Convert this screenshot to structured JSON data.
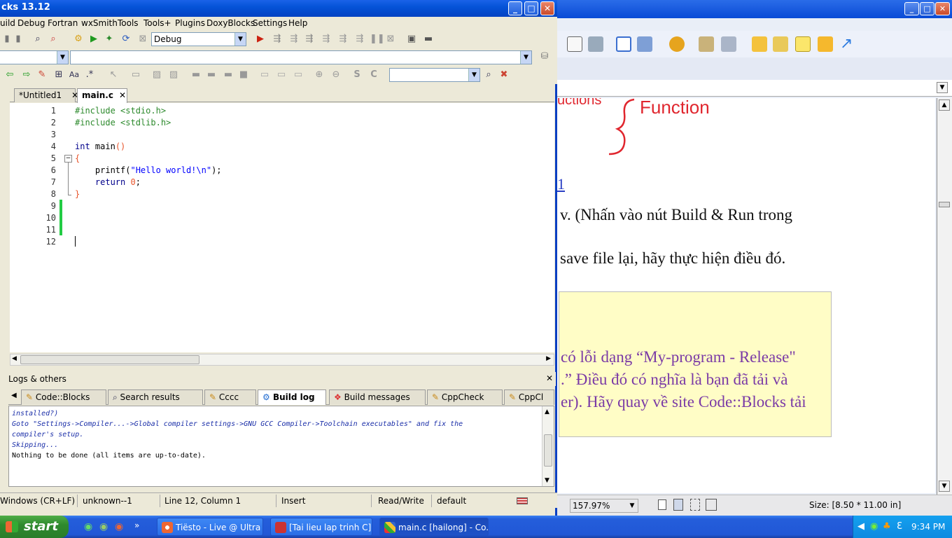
{
  "cb": {
    "title": "cks 13.12",
    "menus": [
      "uild",
      "Debug",
      "Fortran",
      "wxSmith",
      "Tools",
      "Tools+",
      "Plugins",
      "DoxyBlocks",
      "Settings",
      "Help"
    ],
    "build_target": "Debug",
    "tabs": [
      {
        "label": "*Untitled1",
        "close": "✕"
      },
      {
        "label": "main.c",
        "close": "✕"
      }
    ],
    "line_numbers": [
      "1",
      "2",
      "3",
      "4",
      "5",
      "6",
      "7",
      "8",
      "9",
      "10",
      "11",
      "12"
    ],
    "code": {
      "l1": "#include <stdio.h>",
      "l2": "#include <stdlib.h>",
      "l4_kw": "int",
      "l4_rest": " main",
      "l4_paren": "()",
      "l5": "{",
      "l6_indent": "    ",
      "l6_fn": "printf(",
      "l6_str": "\"Hello world!\\n\"",
      "l6_end": ");",
      "l7_indent": "    ",
      "l7_kw": "return",
      "l7_num": " 0",
      "l7_end": ";",
      "l8": "}"
    },
    "logs": {
      "title": "Logs & others",
      "close": "✕",
      "tabs": [
        "Code::Blocks",
        "Search results",
        "Cccc",
        "Build log",
        "Build messages",
        "CppCheck",
        "CppCl"
      ],
      "lines": [
        {
          "text": "installed?)",
          "style": "i"
        },
        {
          "text": "Goto \"Settings->Compiler...->Global compiler settings->GNU GCC Compiler->Toolchain executables\" and fix the",
          "style": "i"
        },
        {
          "text": "compiler's setup.",
          "style": "i"
        },
        {
          "text": "Skipping...",
          "style": "i"
        },
        {
          "text": "Nothing to be done (all items are up-to-date).",
          "style": "n"
        }
      ]
    },
    "status": {
      "eol": "Windows (CR+LF)",
      "encoding": "unknown--1",
      "position": "Line 12, Column 1",
      "mode": "Insert",
      "access": "Read/Write",
      "profile": "default"
    },
    "controls": {
      "min": "_",
      "max": "□",
      "close": "✕"
    }
  },
  "doc": {
    "annotation": "Function",
    "annotation_partial": "uctions",
    "link_fragment": "1",
    "para1": "v. (Nhấn  vào  nút Build  &  Run trong",
    "para2": "save file lại, hãy thực hiện điều đó.",
    "note_line1": "có lỗi dạng “My-program - Release\"",
    "note_line2": ".”  Điều đó có nghĩa là bạn đã tải và",
    "note_line3": "er). Hãy quay về site Code::Blocks tải",
    "zoom": "157.97%",
    "size": "Size: [8.50 * 11.00 in]"
  },
  "taskbar": {
    "start": "start",
    "tasks": [
      "Tiësto - Live @ Ultra ...",
      "[Tai lieu lap trinh C] - ...",
      "main.c [hailong] - Co..."
    ],
    "clock": "9:34 PM"
  },
  "colors": {
    "accent": "#0553d8",
    "annotation_red": "#e0262e",
    "note_bg": "#fffdc6",
    "note_text": "#7a3aa6",
    "changebar": "#22cc44"
  }
}
